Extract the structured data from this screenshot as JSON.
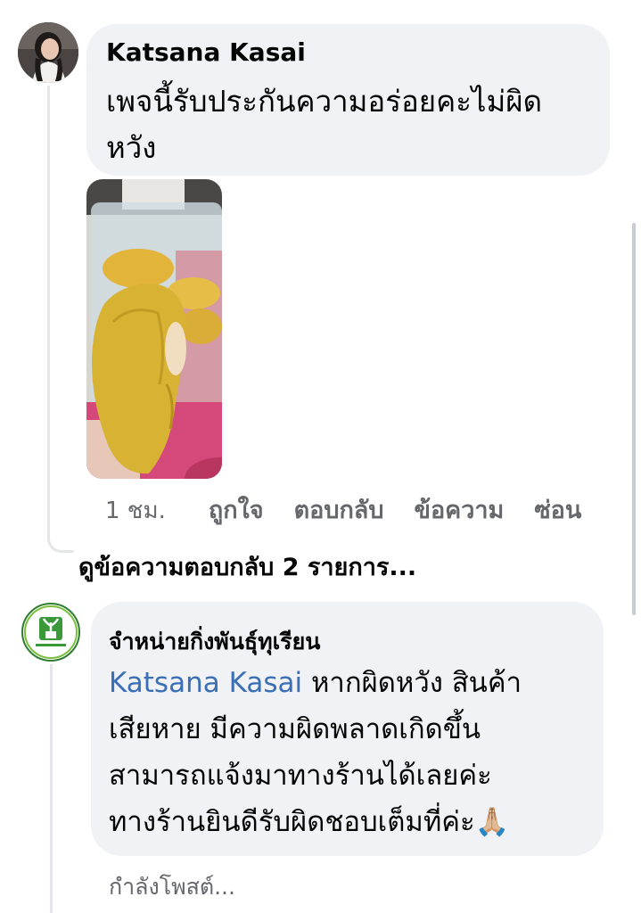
{
  "comment1": {
    "author": "Katsana Kasai",
    "text_lines": [
      "เพจนี้รับประกันความอร่อยคะไม่ผิด",
      "หวัง"
    ],
    "photo_alt": "durian-photo",
    "time": "1 ชม.",
    "actions": [
      "ถูกใจ",
      "ตอบกลับ",
      "ข้อความ",
      "ซ่อน"
    ]
  },
  "view_replies": "ดูข้อความตอบกลับ 2 รายการ...",
  "comment2": {
    "author": "จำหน่ายกิ่งพันธุ์ทุเรียน",
    "mention": "Katsana Kasai",
    "first_line_rest": " หากผิดหวัง สินค้า",
    "text_lines": [
      "เสียหาย มีความผิดพลาดเกิดขึ้น",
      "สามารถแจ้งมาทางร้านได้เลยค่ะ",
      "ทางร้านยินดีรับผิดชอบเต็มที่ค่ะ🙏🏼"
    ],
    "status": "กำลังโพสต์..."
  }
}
